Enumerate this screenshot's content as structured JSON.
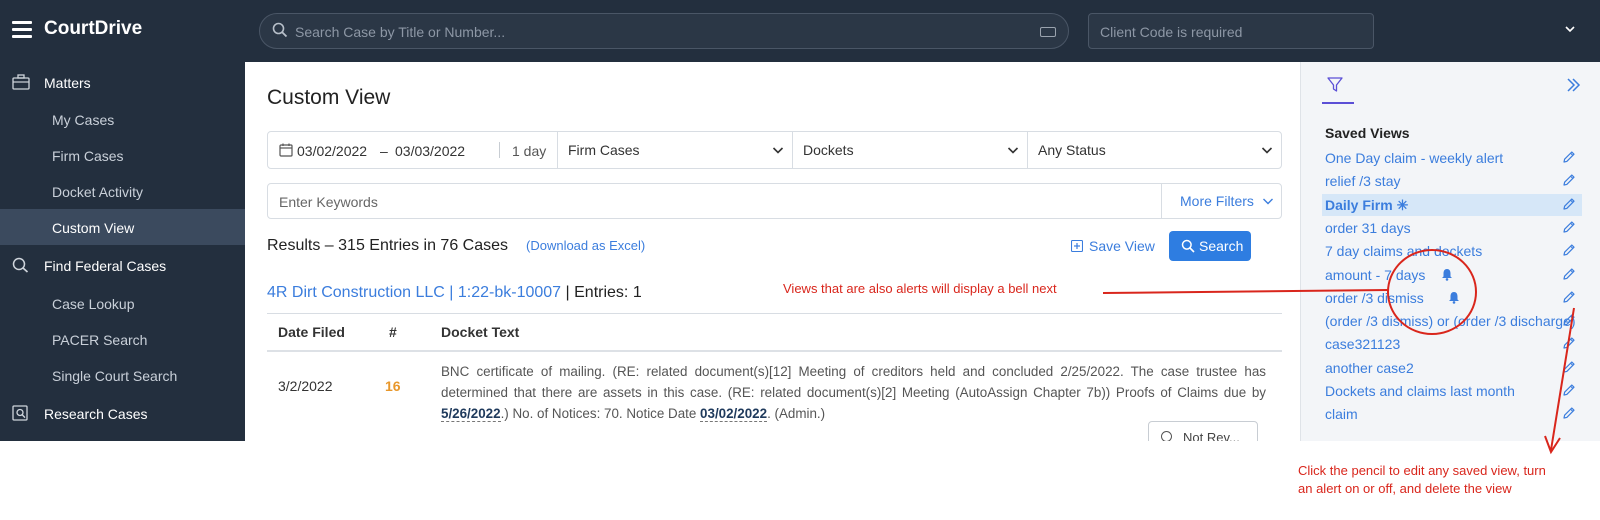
{
  "topbar": {
    "brand": "CourtDrive",
    "search_placeholder": "Search Case by Title or Number...",
    "client_placeholder": "Client Code is required"
  },
  "sidebar": {
    "sections": [
      {
        "label": "Matters",
        "icon": "briefcase-icon"
      },
      {
        "label": "Find Federal Cases",
        "icon": "search-icon"
      },
      {
        "label": "Research Cases",
        "icon": "research-icon"
      }
    ],
    "items": [
      {
        "label": "My Cases"
      },
      {
        "label": "Firm Cases"
      },
      {
        "label": "Docket Activity"
      },
      {
        "label": "Custom View",
        "active": true
      },
      {
        "label": "Case Lookup"
      },
      {
        "label": "PACER Search"
      },
      {
        "label": "Single Court Search"
      }
    ]
  },
  "main": {
    "title": "Custom View",
    "filters": {
      "date_from": "03/02/2022",
      "date_sep": "–",
      "date_to": "03/03/2022",
      "days": "1 day",
      "case_scope": "Firm Cases",
      "type": "Dockets",
      "status": "Any Status"
    },
    "keywords_placeholder": "Enter Keywords",
    "more_filters": "More Filters",
    "results_text": "Results – 315 Entries in 76 Cases",
    "download_label": "(Download as Excel)",
    "save_view_label": "Save View",
    "search_label": "Search",
    "case": {
      "title": "4R Dirt Construction LLC | 1:22-bk-10007",
      "entries": " | Entries: 1"
    },
    "table": {
      "headers": [
        "Date Filed",
        "#",
        "Docket Text"
      ],
      "row": {
        "date": "3/2/2022",
        "num": "16",
        "text_1": "BNC certificate of mailing. (RE: related document(s)[12] Meeting of creditors held and concluded 2/25/2022. The case trustee has determined that there are assets in this case. (RE: related document(s)[2] Meeting (AutoAssign Chapter 7b)) Proofs of Claims due by ",
        "date_link_1": "5/26/2022",
        "text_2": ".) No. of Notices: 70. Notice Date ",
        "date_link_2": "03/02/2022",
        "text_3": ". (Admin.)"
      },
      "button_label": "Not Rev..."
    }
  },
  "rightpanel": {
    "heading": "Saved Views",
    "views": [
      {
        "label": "One Day claim - weekly alert",
        "alert": false
      },
      {
        "label": "relief /3 stay",
        "alert": false
      },
      {
        "label": "Daily Firm ✳",
        "alert": false,
        "active": true
      },
      {
        "label": "order 31 days",
        "alert": false
      },
      {
        "label": "7 day claims and dockets",
        "alert": false
      },
      {
        "label": "amount - 7 days",
        "alert": true
      },
      {
        "label": "order /3 dismiss",
        "alert": true
      },
      {
        "label": "(order /3 dismiss) or (order /3 discharge)",
        "alert": false
      },
      {
        "label": "case321123",
        "alert": false
      },
      {
        "label": "another case2",
        "alert": false
      },
      {
        "label": "Dockets and claims last month",
        "alert": false
      },
      {
        "label": "claim",
        "alert": false
      }
    ]
  },
  "annotations": {
    "bell_note": "Views that are also alerts will display a bell next",
    "pencil_note_1": "Click the pencil to edit any saved view, turn",
    "pencil_note_2": "an alert on or off, and delete the view"
  },
  "colors": {
    "nav_bg": "#232f3e",
    "accent": "#3b7ddd",
    "search_button": "#2e7de1",
    "annotation": "#d9261c",
    "docket_number": "#e8972a"
  }
}
